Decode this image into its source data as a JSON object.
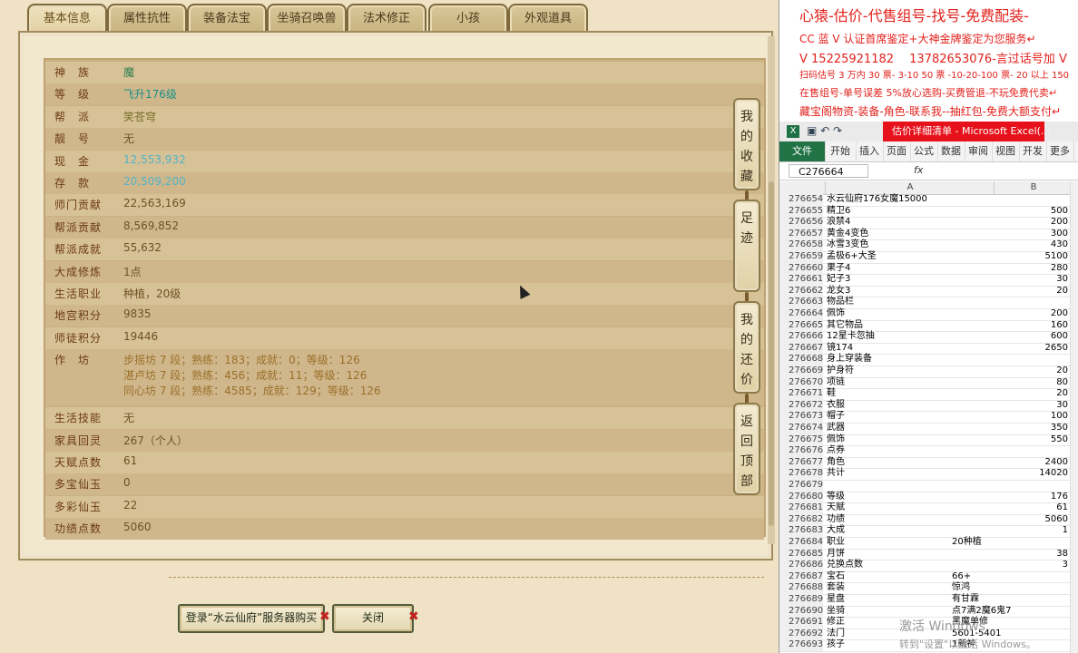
{
  "tabs": [
    "基本信息",
    "属性抗性",
    "装备法宝",
    "坐骑召唤兽",
    "法术修正",
    "小孩",
    "外观道具"
  ],
  "info": [
    {
      "k": "神　族",
      "v": "魔",
      "style": "green"
    },
    {
      "k": "等　级",
      "v": "飞升176级",
      "style": "teal"
    },
    {
      "k": "帮　派",
      "v": "笑苍穹",
      "style": "olive"
    },
    {
      "k": "靓　号",
      "v": "无",
      "style": ""
    },
    {
      "k": "现　金",
      "v": "12,553,932",
      "style": "cyan"
    },
    {
      "k": "存　款",
      "v": "20,509,200",
      "style": "cyan"
    },
    {
      "k": "师门贡献",
      "v": "22,563,169",
      "style": ""
    },
    {
      "k": "帮派贡献",
      "v": "8,569,852",
      "style": ""
    },
    {
      "k": "帮派成就",
      "v": "55,632",
      "style": ""
    },
    {
      "k": "大成修炼",
      "v": "1点",
      "style": ""
    },
    {
      "k": "生活职业",
      "v": "种植，20级",
      "style": ""
    },
    {
      "k": "地宫积分",
      "v": "9835",
      "style": ""
    },
    {
      "k": "师徒积分",
      "v": "19446",
      "style": ""
    }
  ],
  "workshop": {
    "k": "作　坊",
    "lines": [
      "步摇坊 7 段；熟练：183；成就：0；等级：126",
      "湛卢坊 7 段；熟练：456；成就：11；等级：126",
      "同心坊 7 段；熟练：4585；成就：129；等级：126"
    ]
  },
  "info2": [
    {
      "k": "生活技能",
      "v": "无"
    },
    {
      "k": "家具回灵",
      "v": "267（个人）"
    },
    {
      "k": "天赋点数",
      "v": "61"
    },
    {
      "k": "多宝仙玉",
      "v": "0"
    },
    {
      "k": "多彩仙玉",
      "v": "22"
    },
    {
      "k": "功绩点数",
      "v": "5060"
    }
  ],
  "side_buttons": [
    {
      "name": "favorite",
      "chars": [
        "我",
        "的",
        "收",
        "藏"
      ]
    },
    {
      "name": "footprint",
      "chars": [
        "足",
        "迹"
      ]
    },
    {
      "name": "my-offer",
      "chars": [
        "我",
        "的",
        "还",
        "价"
      ]
    },
    {
      "name": "back-top",
      "chars": [
        "返",
        "回",
        "顶",
        "部"
      ]
    }
  ],
  "buttons": {
    "login": "登录“水云仙府”服务器购买",
    "close": "关闭"
  },
  "promo": [
    "心猿-估价-代售组号-找号-免费配装-",
    "CC 蓝 V 认证首席鉴定+大神金牌鉴定为您服务↵",
    "V 15225921182 　13782653076-言过话号加 V",
    "扫码估号 3 万内 30 票- 3-10 50 票 -10-20-100 票- 20 以上 150",
    "在售组号-单号误差 5%放心选购-买费管退-不玩免费代卖↵",
    "藏宝阁物资-装备-角色-联系我--抽红包-免费大额支付↵"
  ],
  "excel": {
    "title": "估价详细清单 - Microsoft Excel(...",
    "logo": "X",
    "ribbon": [
      "文件",
      "开始",
      "插入",
      "页面",
      "公式",
      "数据",
      "审阅",
      "视图",
      "开发",
      "更多"
    ],
    "namebox": "C276664",
    "fx": "fx",
    "col_a": "A",
    "col_b": "B",
    "rows": [
      [
        "276654",
        "水云仙府176女魔15000",
        ""
      ],
      [
        "276655",
        "精卫6",
        "500"
      ],
      [
        "276656",
        "浪禁4",
        "200"
      ],
      [
        "276657",
        "黄金4变色",
        "300"
      ],
      [
        "276658",
        "冰雪3变色",
        "430"
      ],
      [
        "276659",
        "孟极6+大圣",
        "5100"
      ],
      [
        "276660",
        "果子4",
        "280"
      ],
      [
        "276661",
        "妃子3",
        "30"
      ],
      [
        "276662",
        "龙女3",
        "20"
      ],
      [
        "276663",
        "物品栏",
        ""
      ],
      [
        "276664",
        "佩饰",
        "200"
      ],
      [
        "276665",
        "其它物品",
        "160"
      ],
      [
        "276666",
        "12星卡忽抽",
        "600"
      ],
      [
        "276667",
        "镜174",
        "2650"
      ],
      [
        "276668",
        "身上穿装备",
        ""
      ],
      [
        "276669",
        "护身符",
        "20"
      ],
      [
        "276670",
        "项链",
        "80"
      ],
      [
        "276671",
        "鞋",
        "20"
      ],
      [
        "276672",
        "衣服",
        "30"
      ],
      [
        "276673",
        "帽子",
        "100"
      ],
      [
        "276674",
        "武器",
        "350"
      ],
      [
        "276675",
        "佩饰",
        "550"
      ],
      [
        "276676",
        "点券",
        ""
      ],
      [
        "276677",
        "角色",
        "2400"
      ],
      [
        "276678",
        "共计",
        "14020"
      ],
      [
        "276679",
        "",
        ""
      ],
      [
        "276680",
        "等级",
        "176"
      ],
      [
        "276681",
        "天赋",
        "61"
      ],
      [
        "276682",
        "功绩",
        "5060"
      ],
      [
        "276683",
        "大成",
        "1"
      ],
      [
        "276684",
        "职业",
        "20种植"
      ],
      [
        "276685",
        "月饼",
        "38"
      ],
      [
        "276686",
        "兑换点数",
        "3"
      ],
      [
        "276687",
        "宝石",
        "66+"
      ],
      [
        "276688",
        "套装",
        "惊鸿"
      ],
      [
        "276689",
        "星盘",
        "有甘霖"
      ],
      [
        "276690",
        "坐骑",
        "点7满2魔6鬼7"
      ],
      [
        "276691",
        "修正",
        "黑魔单修"
      ],
      [
        "276692",
        "法门",
        "5601-5401"
      ],
      [
        "276693",
        "孩子",
        "1新神"
      ]
    ],
    "left_text_b_rows": [
      "276684",
      "276687",
      "276688",
      "276689",
      "276690",
      "276691",
      "276692",
      "276693"
    ]
  },
  "watermark": {
    "line1": "激活 Windows",
    "line2": "转到\"设置\"以激活 Windows。"
  },
  "colors": {
    "promo_red": "#e2211c",
    "excel_green": "#217346",
    "title_red": "#e6111a"
  }
}
